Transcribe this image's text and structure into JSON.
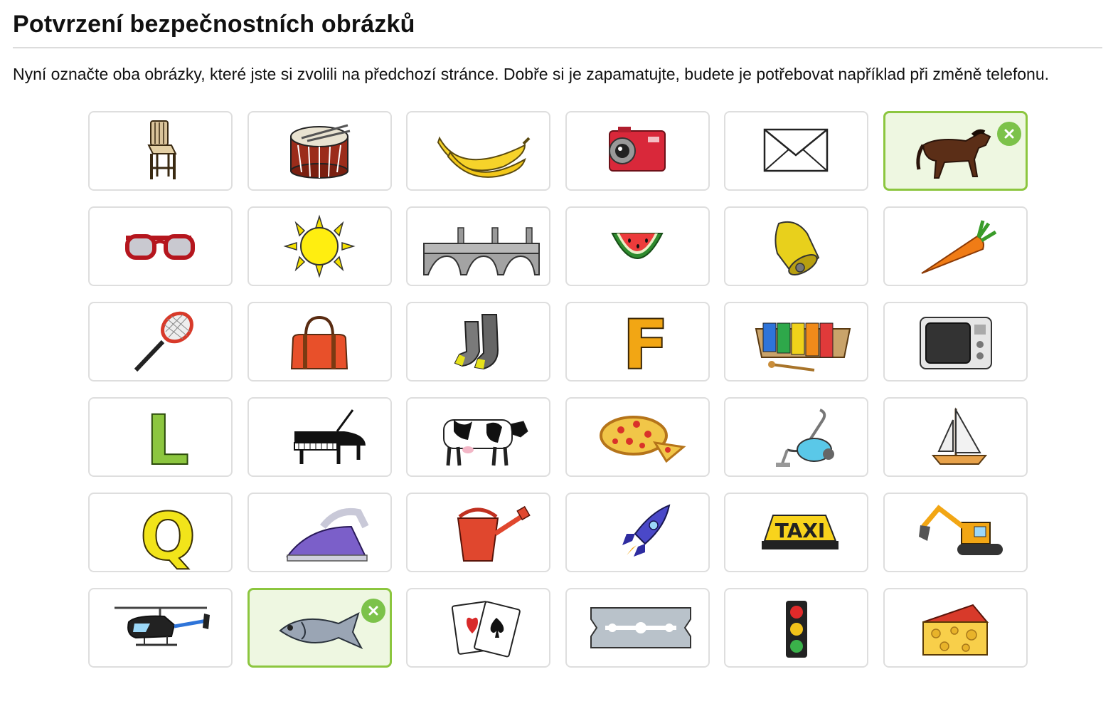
{
  "page": {
    "title": "Potvrzení bezpečnostních obrázků",
    "instructions": "Nyní označte oba obrázky, které jste si zvolili na předchozí stránce. Dobře si je zapamatujte, budete je potřebovat například při změně telefonu."
  },
  "colors": {
    "selected_border": "#8cc63f",
    "selected_bg": "#eef7e1",
    "remove_badge": "#7cc24a"
  },
  "tiles": [
    {
      "icon": "chair-icon",
      "selected": false
    },
    {
      "icon": "drum-icon",
      "selected": false
    },
    {
      "icon": "banana-icon",
      "selected": false
    },
    {
      "icon": "camera-icon",
      "selected": false
    },
    {
      "icon": "envelope-icon",
      "selected": false
    },
    {
      "icon": "horse-icon",
      "selected": true
    },
    {
      "icon": "sunglasses-icon",
      "selected": false
    },
    {
      "icon": "sun-icon",
      "selected": false
    },
    {
      "icon": "bridge-icon",
      "selected": false
    },
    {
      "icon": "watermelon-icon",
      "selected": false
    },
    {
      "icon": "bell-icon",
      "selected": false
    },
    {
      "icon": "carrot-icon",
      "selected": false
    },
    {
      "icon": "tennis-racket-icon",
      "selected": false
    },
    {
      "icon": "bag-icon",
      "selected": false
    },
    {
      "icon": "socks-icon",
      "selected": false
    },
    {
      "icon": "letter-f-icon",
      "selected": false
    },
    {
      "icon": "xylophone-icon",
      "selected": false
    },
    {
      "icon": "microwave-icon",
      "selected": false
    },
    {
      "icon": "letter-l-icon",
      "selected": false
    },
    {
      "icon": "piano-icon",
      "selected": false
    },
    {
      "icon": "cow-icon",
      "selected": false
    },
    {
      "icon": "pizza-icon",
      "selected": false
    },
    {
      "icon": "vacuum-cleaner-icon",
      "selected": false
    },
    {
      "icon": "sailboat-icon",
      "selected": false
    },
    {
      "icon": "letter-q-icon",
      "selected": false
    },
    {
      "icon": "iron-icon",
      "selected": false
    },
    {
      "icon": "watering-can-icon",
      "selected": false
    },
    {
      "icon": "rocket-icon",
      "selected": false
    },
    {
      "icon": "taxi-sign-icon",
      "selected": false
    },
    {
      "icon": "excavator-icon",
      "selected": false
    },
    {
      "icon": "helicopter-icon",
      "selected": false
    },
    {
      "icon": "fish-icon",
      "selected": true
    },
    {
      "icon": "playing-cards-icon",
      "selected": false
    },
    {
      "icon": "razor-blade-icon",
      "selected": false
    },
    {
      "icon": "traffic-light-icon",
      "selected": false
    },
    {
      "icon": "cheese-icon",
      "selected": false
    }
  ],
  "taxi_sign_text": "TAXI",
  "letters": {
    "f": "F",
    "l": "L",
    "q": "Q"
  }
}
